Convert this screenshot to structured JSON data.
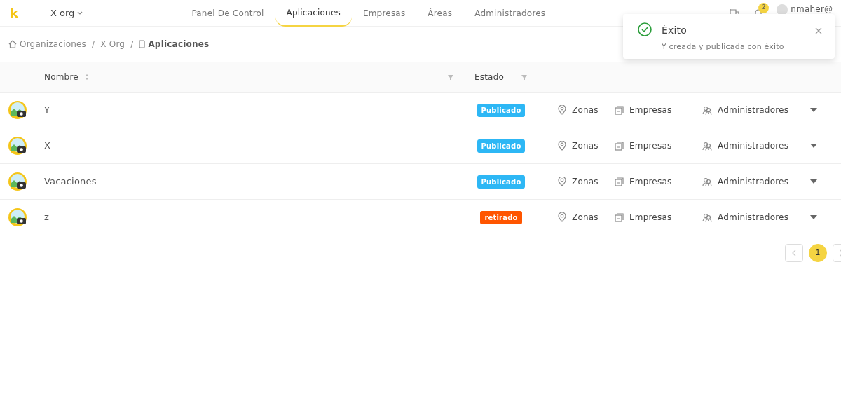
{
  "header": {
    "logo": "k",
    "org": "X org",
    "nav": [
      {
        "label": "Panel De Control",
        "selected": false
      },
      {
        "label": "Aplicaciones",
        "selected": true
      },
      {
        "label": "Empresas",
        "selected": false
      },
      {
        "label": "Áreas",
        "selected": false
      },
      {
        "label": "Administradores",
        "selected": false
      }
    ],
    "notifications": "2",
    "user": "nmaher@"
  },
  "breadcrumb": [
    "Organizaciones",
    "X Org",
    "Aplicaciones"
  ],
  "breadcrumb_separators": [
    "/",
    "/"
  ],
  "table": {
    "columns": [
      "Nombre",
      "Estado"
    ],
    "rows": [
      {
        "name": "Y",
        "status": "Publicado",
        "color": "#2db7f5",
        "links": [
          "Zonas",
          "Empresas",
          "Administradores"
        ]
      },
      {
        "name": "X",
        "status": "Publicado",
        "color": "#2db7f5",
        "links": [
          "Zonas",
          "Empresas",
          "Administradores"
        ]
      },
      {
        "name": "Vacaciones",
        "status": "Publicado",
        "color": "#2db7f5",
        "links": [
          "Zonas",
          "Empresas",
          "Administradores"
        ]
      },
      {
        "name": "z",
        "status": "retirado",
        "color": "#ff5500",
        "links": [
          "Zonas",
          "Empresas",
          "Administradores"
        ]
      }
    ]
  },
  "pagination": [
    {
      "label": "1",
      "selected": true
    }
  ],
  "toast": {
    "title": "Éxito",
    "message": "Y creada y publicada con éxito"
  }
}
